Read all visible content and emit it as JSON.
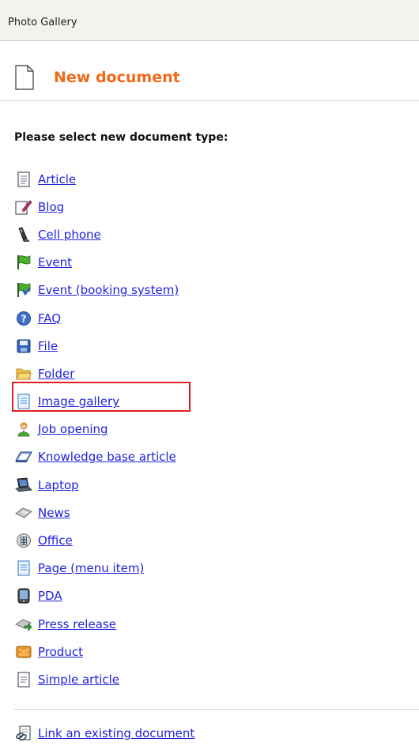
{
  "breadcrumb": {
    "text": "Photo Gallery"
  },
  "header": {
    "title": "New document",
    "title_color": "#f06a1a"
  },
  "prompt": "Please select new document type:",
  "link_color": "#2222dd",
  "highlight_color": "#e02020",
  "document_types": [
    {
      "label": "Article",
      "icon": "article-icon"
    },
    {
      "label": "Blog",
      "icon": "blog-icon"
    },
    {
      "label": "Cell phone",
      "icon": "cell-phone-icon"
    },
    {
      "label": "Event",
      "icon": "event-flag-icon"
    },
    {
      "label": "Event (booking system)",
      "icon": "event-booking-icon"
    },
    {
      "label": "FAQ",
      "icon": "faq-help-icon"
    },
    {
      "label": "File",
      "icon": "file-save-icon"
    },
    {
      "label": "Folder",
      "icon": "folder-icon"
    },
    {
      "label": "Image gallery",
      "icon": "image-gallery-icon",
      "highlighted": true
    },
    {
      "label": "Job opening",
      "icon": "job-opening-icon"
    },
    {
      "label": "Knowledge base article",
      "icon": "knowledge-base-icon"
    },
    {
      "label": "Laptop",
      "icon": "laptop-icon"
    },
    {
      "label": "News",
      "icon": "news-icon"
    },
    {
      "label": "Office",
      "icon": "office-icon"
    },
    {
      "label": "Page (menu item)",
      "icon": "page-menu-item-icon"
    },
    {
      "label": "PDA",
      "icon": "pda-icon"
    },
    {
      "label": "Press release",
      "icon": "press-release-icon"
    },
    {
      "label": "Product",
      "icon": "product-icon"
    },
    {
      "label": "Simple article",
      "icon": "simple-article-icon"
    }
  ],
  "footer": {
    "link_label": "Link an existing document",
    "icon": "link-document-icon"
  }
}
